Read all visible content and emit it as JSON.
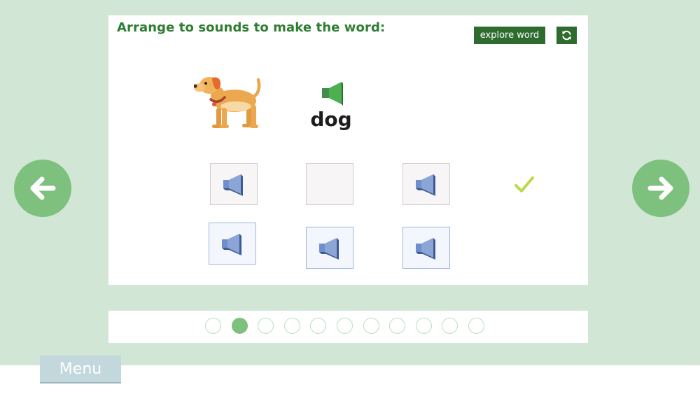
{
  "colors": {
    "background": "#d2e6d6",
    "title_green": "#2e7d32",
    "button_dark_green": "#2e6b2f",
    "nav_green": "#7ec17e",
    "tile_blue": "#8aa5d6",
    "check_green": "#bcd94a"
  },
  "activity": {
    "title": "Arrange to sounds to make the word:",
    "explore_button": "explore word",
    "refresh_icon": "refresh-icon",
    "picture_icon": "dog-icon",
    "word_speaker_icon": "speaker-icon",
    "word": "dog"
  },
  "slots": [
    {
      "filled": true,
      "icon": "speaker-icon"
    },
    {
      "filled": false,
      "icon": ""
    },
    {
      "filled": true,
      "icon": "speaker-icon"
    }
  ],
  "tiles": [
    {
      "icon": "speaker-icon"
    },
    {
      "icon": "speaker-icon"
    },
    {
      "icon": "speaker-icon"
    }
  ],
  "check_icon": "checkmark-icon",
  "navigation": {
    "prev_icon": "arrow-left-icon",
    "next_icon": "arrow-right-icon"
  },
  "progress": {
    "total": 11,
    "current": 2
  },
  "menu_label": "Menu"
}
